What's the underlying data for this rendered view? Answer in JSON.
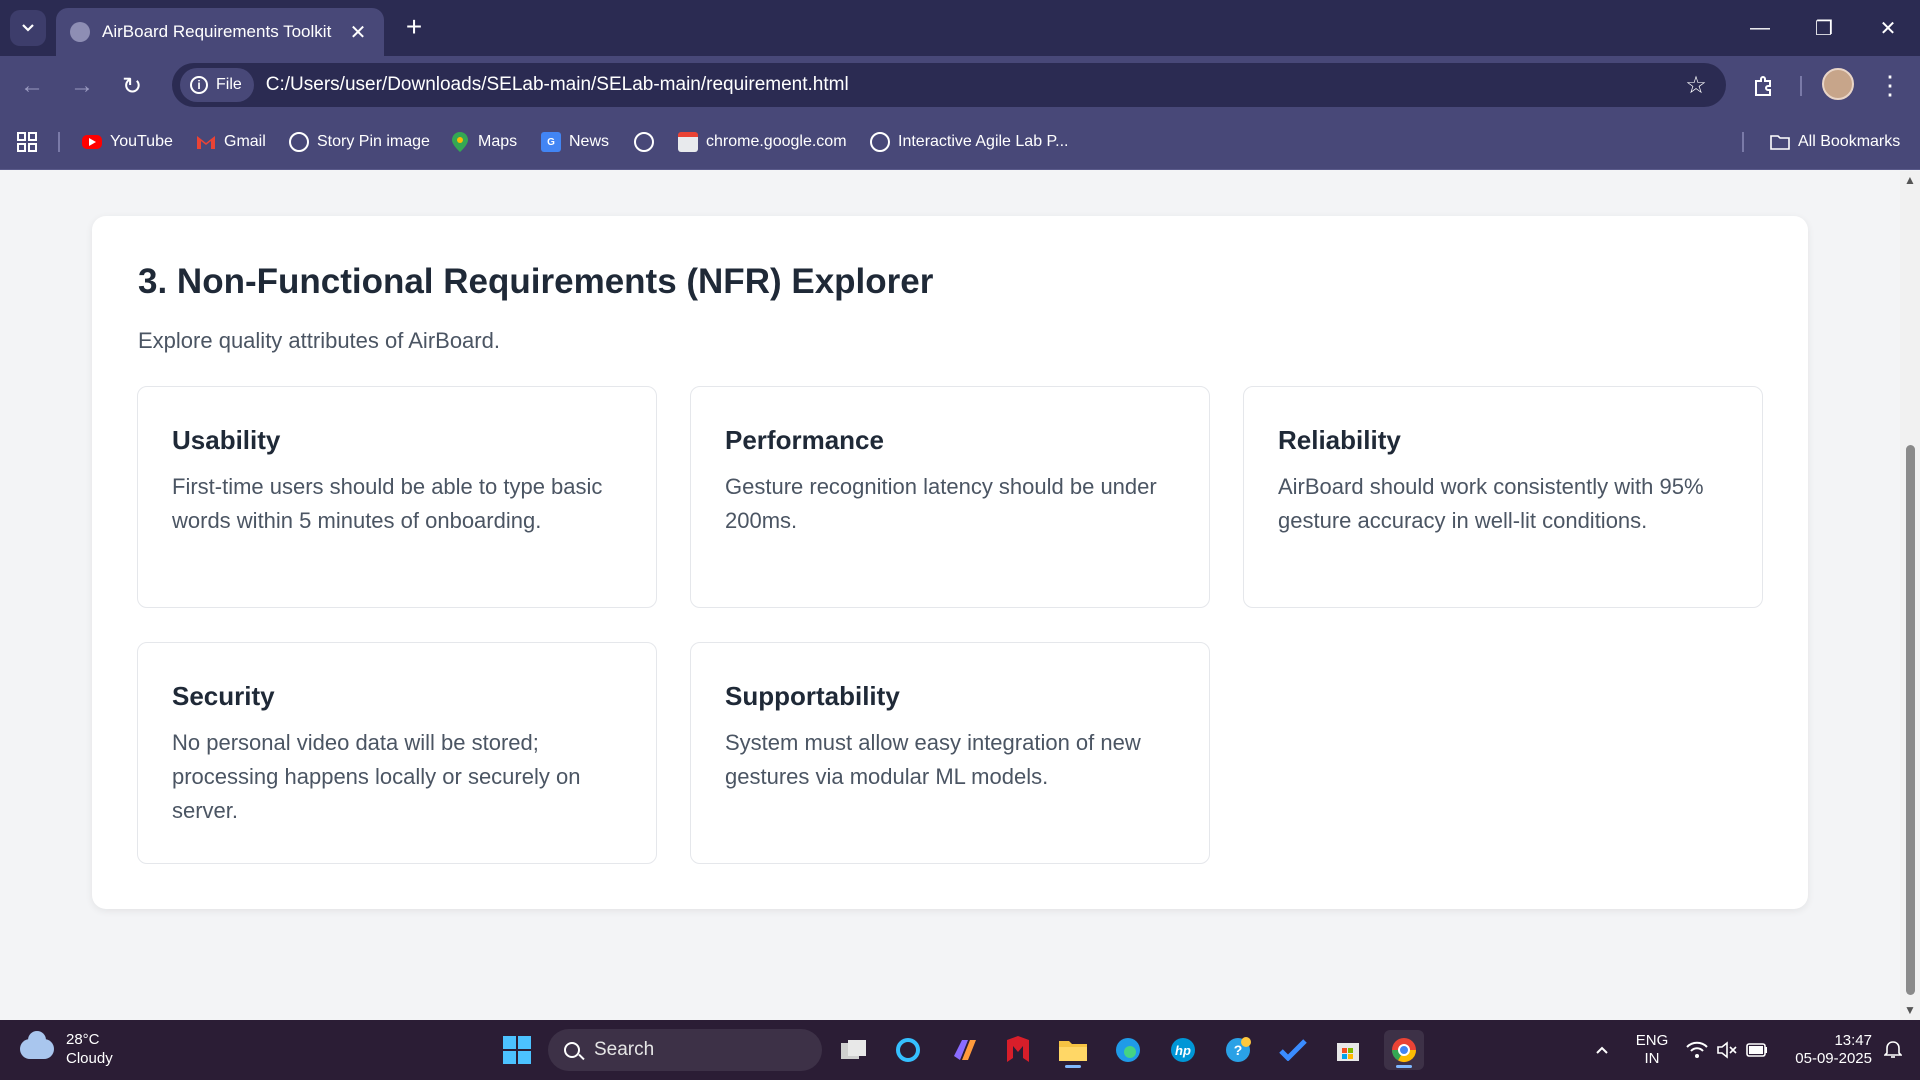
{
  "browser": {
    "tab": {
      "title": "AirBoard Requirements Toolkit",
      "close_glyph": "✕"
    },
    "new_tab_glyph": "+",
    "window_controls": {
      "minimize": "—",
      "restore": "❐",
      "close": "✕"
    },
    "nav": {
      "back": "←",
      "forward": "→",
      "reload": "↻"
    },
    "address": {
      "chip_label": "File",
      "url": "C:/Users/user/Downloads/SELab-main/SELab-main/requirement.html"
    },
    "star_glyph": "☆",
    "menu_glyph": "⋮",
    "bookmarks": [
      {
        "label": "YouTube",
        "icon": "youtube-icon"
      },
      {
        "label": "Gmail",
        "icon": "gmail-icon"
      },
      {
        "label": "Story Pin image",
        "icon": "globe-icon"
      },
      {
        "label": "Maps",
        "icon": "maps-icon"
      },
      {
        "label": "News",
        "icon": "news-icon"
      },
      {
        "label": "",
        "icon": "globe-icon"
      },
      {
        "label": "chrome.google.com",
        "icon": "chrome-web-store-icon"
      },
      {
        "label": "Interactive Agile Lab P...",
        "icon": "globe-icon"
      }
    ],
    "all_bookmarks": "All Bookmarks"
  },
  "section": {
    "title": "3. Non-Functional Requirements (NFR) Explorer",
    "subtitle": "Explore quality attributes of AirBoard.",
    "cards": [
      {
        "title": "Usability",
        "text": "First-time users should be able to type basic words within 5 minutes of onboarding."
      },
      {
        "title": "Performance",
        "text": "Gesture recognition latency should be under 200ms."
      },
      {
        "title": "Reliability",
        "text": "AirBoard should work consistently with 95% gesture accuracy in well-lit conditions."
      },
      {
        "title": "Security",
        "text": "No personal video data will be stored; processing happens locally or securely on server."
      },
      {
        "title": "Supportability",
        "text": "System must allow easy integration of new gestures via modular ML models."
      }
    ]
  },
  "taskbar": {
    "weather": {
      "temp": "28°C",
      "condition": "Cloudy"
    },
    "search_placeholder": "Search",
    "language": {
      "line1": "ENG",
      "line2": "IN"
    },
    "clock": {
      "time": "13:47",
      "date": "05-09-2025"
    }
  },
  "colors": {
    "chrome_dark": "#2b2b52",
    "chrome_mid": "#484878",
    "page_bg": "#f3f4f6",
    "taskbar": "#2b1d35"
  }
}
